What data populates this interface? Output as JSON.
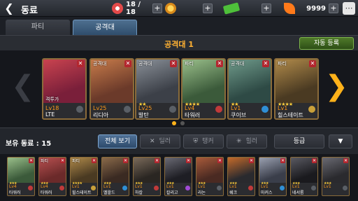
{
  "header": {
    "title": "동료",
    "resources": [
      {
        "icon": "lollipop-icon",
        "value": "18 / 18",
        "color": "#e44a4a"
      },
      {
        "icon": "gold-coin-icon",
        "value": "",
        "color": "#f2a516"
      },
      {
        "icon": "cash-icon",
        "value": "",
        "color": "#4ec03a"
      },
      {
        "icon": "carrot-icon",
        "value": "9999",
        "color": "#ff7a1a"
      }
    ]
  },
  "tabs": [
    {
      "label": "파티",
      "active": false
    },
    {
      "label": "공격대",
      "active": true
    }
  ],
  "squad": {
    "title": "공격대 1",
    "auto_label": "자동 등록",
    "page_dots": [
      true,
      false
    ],
    "cards": [
      {
        "role": "",
        "tag": "격투가",
        "stars": "",
        "level": "Lv18",
        "name": "LTE",
        "element": "#5a5f66",
        "colors": [
          "#7a1f3a",
          "#c9434f"
        ]
      },
      {
        "role": "공격대",
        "tag": "",
        "stars": "",
        "level": "Lv25",
        "name": "리디아",
        "element": "#5a5f66",
        "colors": [
          "#6b3a2a",
          "#c77b4a"
        ]
      },
      {
        "role": "공격대",
        "tag": "",
        "stars": "★★",
        "level": "Lv25",
        "name": "발탄",
        "element": "#5a5f66",
        "colors": [
          "#3c4048",
          "#8a9098"
        ]
      },
      {
        "role": "파티",
        "tag": "",
        "stars": "★★★★",
        "level": "Lv4",
        "name": "타워러",
        "element": "#c13a3a",
        "colors": [
          "#3b5a3a",
          "#9abf8a"
        ]
      },
      {
        "role": "공격대",
        "tag": "",
        "stars": "★★",
        "level": "Lv1",
        "name": "쿠이브",
        "element": "#2f8fd6",
        "colors": [
          "#2e4a45",
          "#6f9a8a"
        ]
      },
      {
        "role": "파티",
        "tag": "",
        "stars": "★★★★",
        "level": "Lv1",
        "name": "힐스테이트",
        "element": "#c9a03a",
        "colors": [
          "#4a3a22",
          "#b08a4a"
        ]
      }
    ]
  },
  "roster": {
    "title": "보유 동료 : 15",
    "filters": [
      {
        "label": "전체 보기",
        "icon": "",
        "active": true
      },
      {
        "label": "딜러",
        "icon": "✕",
        "active": false
      },
      {
        "label": "탱커",
        "icon": "⛨",
        "active": false
      },
      {
        "label": "힐러",
        "icon": "✳",
        "active": false
      }
    ],
    "sort_label": "등급",
    "sort_arrow": "▼",
    "items": [
      {
        "role": "",
        "stars": "★★★",
        "level": "Lv4",
        "name": "타워러",
        "element": "#c13a3a",
        "colors": [
          "#3b5a3a",
          "#9abf8a"
        ]
      },
      {
        "role": "파티",
        "stars": "★★★",
        "level": "Lv4",
        "name": "타워러",
        "element": "#c13a3a",
        "colors": [
          "#6b2a2a",
          "#b85050"
        ]
      },
      {
        "role": "파티",
        "stars": "★★★★",
        "level": "Lv1",
        "name": "힐스테이트",
        "element": "#c9a03a",
        "colors": [
          "#4a3a22",
          "#b08a4a"
        ]
      },
      {
        "role": "",
        "stars": "★★★",
        "level": "Lv1",
        "name": "벨왈드",
        "element": "#2f8fd6",
        "colors": [
          "#3a2a22",
          "#8a6a4a"
        ]
      },
      {
        "role": "",
        "stars": "★★★",
        "level": "Lv1",
        "name": "하칼",
        "element": "#c13a3a",
        "colors": [
          "#2a2622",
          "#7a6a5a"
        ]
      },
      {
        "role": "",
        "stars": "★★★",
        "level": "Lv1",
        "name": "칼리고",
        "element": "#a04ad6",
        "colors": [
          "#1e1e24",
          "#6a6a74"
        ]
      },
      {
        "role": "",
        "stars": "★★★",
        "level": "Lv1",
        "name": "라논",
        "element": "#5a5f66",
        "colors": [
          "#4a2a22",
          "#a85a3a"
        ]
      },
      {
        "role": "",
        "stars": "★★★",
        "level": "Lv1",
        "name": "쉐크",
        "element": "#c13a3a",
        "colors": [
          "#2a2a2e",
          "#c46a2a"
        ]
      },
      {
        "role": "",
        "stars": "★★★",
        "level": "Lv1",
        "name": "마커스",
        "element": "#2f8fd6",
        "colors": [
          "#3a3e4a",
          "#9aa0b0"
        ]
      },
      {
        "role": "",
        "stars": "★★★",
        "level": "Lv1",
        "name": "네서룸",
        "element": "#5a5f66",
        "colors": [
          "#1a1a1e",
          "#5a5a62"
        ]
      },
      {
        "role": "",
        "stars": "★★★",
        "level": "Lv1",
        "name": "",
        "element": "#5a5f66",
        "colors": [
          "#2a2a2e",
          "#6a6a72"
        ]
      }
    ]
  }
}
